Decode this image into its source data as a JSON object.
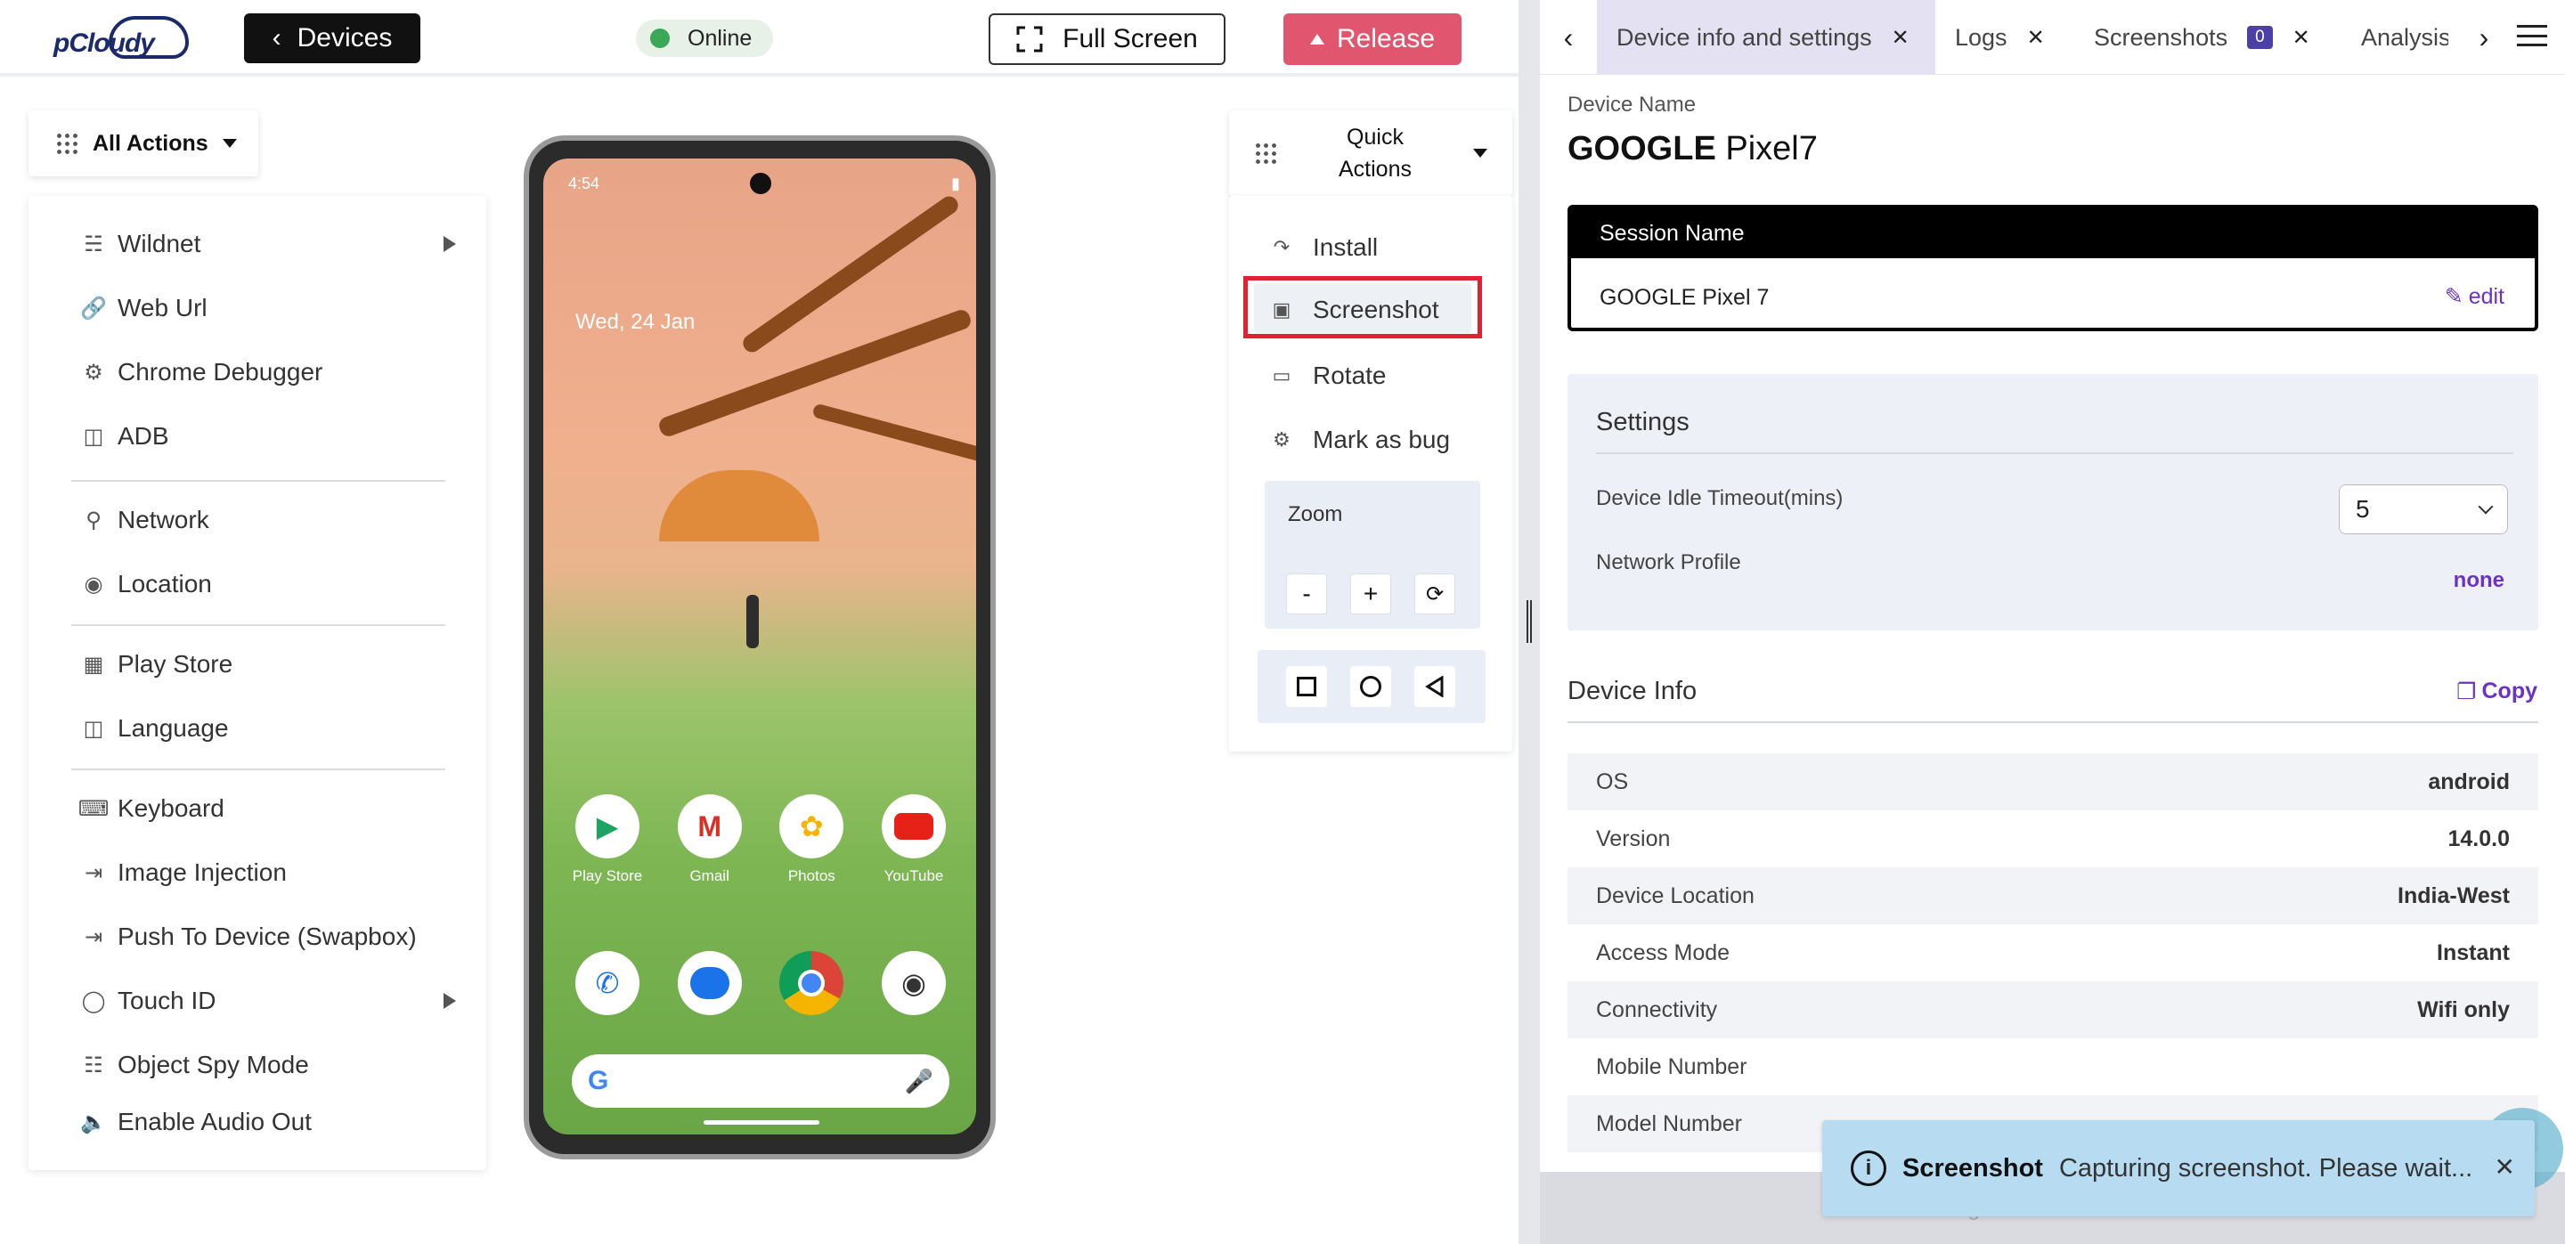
{
  "topbar": {
    "logo": "pCloudy",
    "devices_button": "Devices",
    "online_label": "Online",
    "fullscreen_button": "Full Screen",
    "release_button": "Release"
  },
  "all_actions": {
    "label": "All Actions",
    "items": [
      {
        "label": "Wildnet",
        "icon": "wifi-icon",
        "submenu": true
      },
      {
        "label": "Web Url",
        "icon": "link-icon"
      },
      {
        "label": "Chrome Debugger",
        "icon": "bug-icon"
      },
      {
        "label": "ADB",
        "icon": "adb-icon"
      },
      {
        "label": "Network",
        "icon": "network-icon"
      },
      {
        "label": "Location",
        "icon": "location-icon"
      },
      {
        "label": "Play Store",
        "icon": "apps-icon"
      },
      {
        "label": "Language",
        "icon": "language-icon"
      },
      {
        "label": "Keyboard",
        "icon": "keyboard-icon"
      },
      {
        "label": "Image Injection",
        "icon": "image-injection-icon"
      },
      {
        "label": "Push To Device (Swapbox)",
        "icon": "push-icon"
      },
      {
        "label": "Touch ID",
        "icon": "fingerprint-icon",
        "submenu": true
      },
      {
        "label": "Object Spy Mode",
        "icon": "spy-icon"
      },
      {
        "label": "Enable Audio Out",
        "icon": "audio-icon"
      }
    ]
  },
  "phone": {
    "time": "4:54",
    "date": "Wed, 24 Jan",
    "apps_row1": [
      "Play Store",
      "Gmail",
      "Photos",
      "YouTube"
    ]
  },
  "quick_actions": {
    "label": "Quick Actions",
    "items": [
      {
        "label": "Install",
        "icon": "install-icon"
      },
      {
        "label": "Screenshot",
        "icon": "screenshot-icon"
      },
      {
        "label": "Rotate",
        "icon": "rotate-icon"
      },
      {
        "label": "Mark as bug",
        "icon": "bug-icon"
      }
    ],
    "zoom_label": "Zoom",
    "zoom_minus": "-",
    "zoom_plus": "+"
  },
  "tabs": [
    {
      "label": "Device info and settings",
      "active": true
    },
    {
      "label": "Logs"
    },
    {
      "label": "Screenshots",
      "badge": "0"
    },
    {
      "label": "Analysis"
    }
  ],
  "device": {
    "name_label": "Device Name",
    "brand": "GOOGLE",
    "model": "Pixel7",
    "session_header": "Session Name",
    "session_value": "GOOGLE Pixel 7",
    "edit_label": "edit"
  },
  "settings": {
    "title": "Settings",
    "idle_label": "Device Idle Timeout(mins)",
    "idle_value": "5",
    "network_label": "Network Profile",
    "network_value": "none"
  },
  "device_info": {
    "title": "Device Info",
    "copy_label": "Copy",
    "rows": [
      {
        "k": "OS",
        "v": "android"
      },
      {
        "k": "Version",
        "v": "14.0.0"
      },
      {
        "k": "Device Location",
        "v": "India-West"
      },
      {
        "k": "Access Mode",
        "v": "Instant"
      },
      {
        "k": "Connectivity",
        "v": "Wifi only"
      },
      {
        "k": "Mobile Number",
        "v": ""
      },
      {
        "k": "Model Number",
        "v": ""
      }
    ]
  },
  "dock": {
    "label": "Drag here to Dock tools"
  },
  "toast": {
    "title": "Screenshot",
    "message": "Capturing screenshot. Please wait..."
  }
}
